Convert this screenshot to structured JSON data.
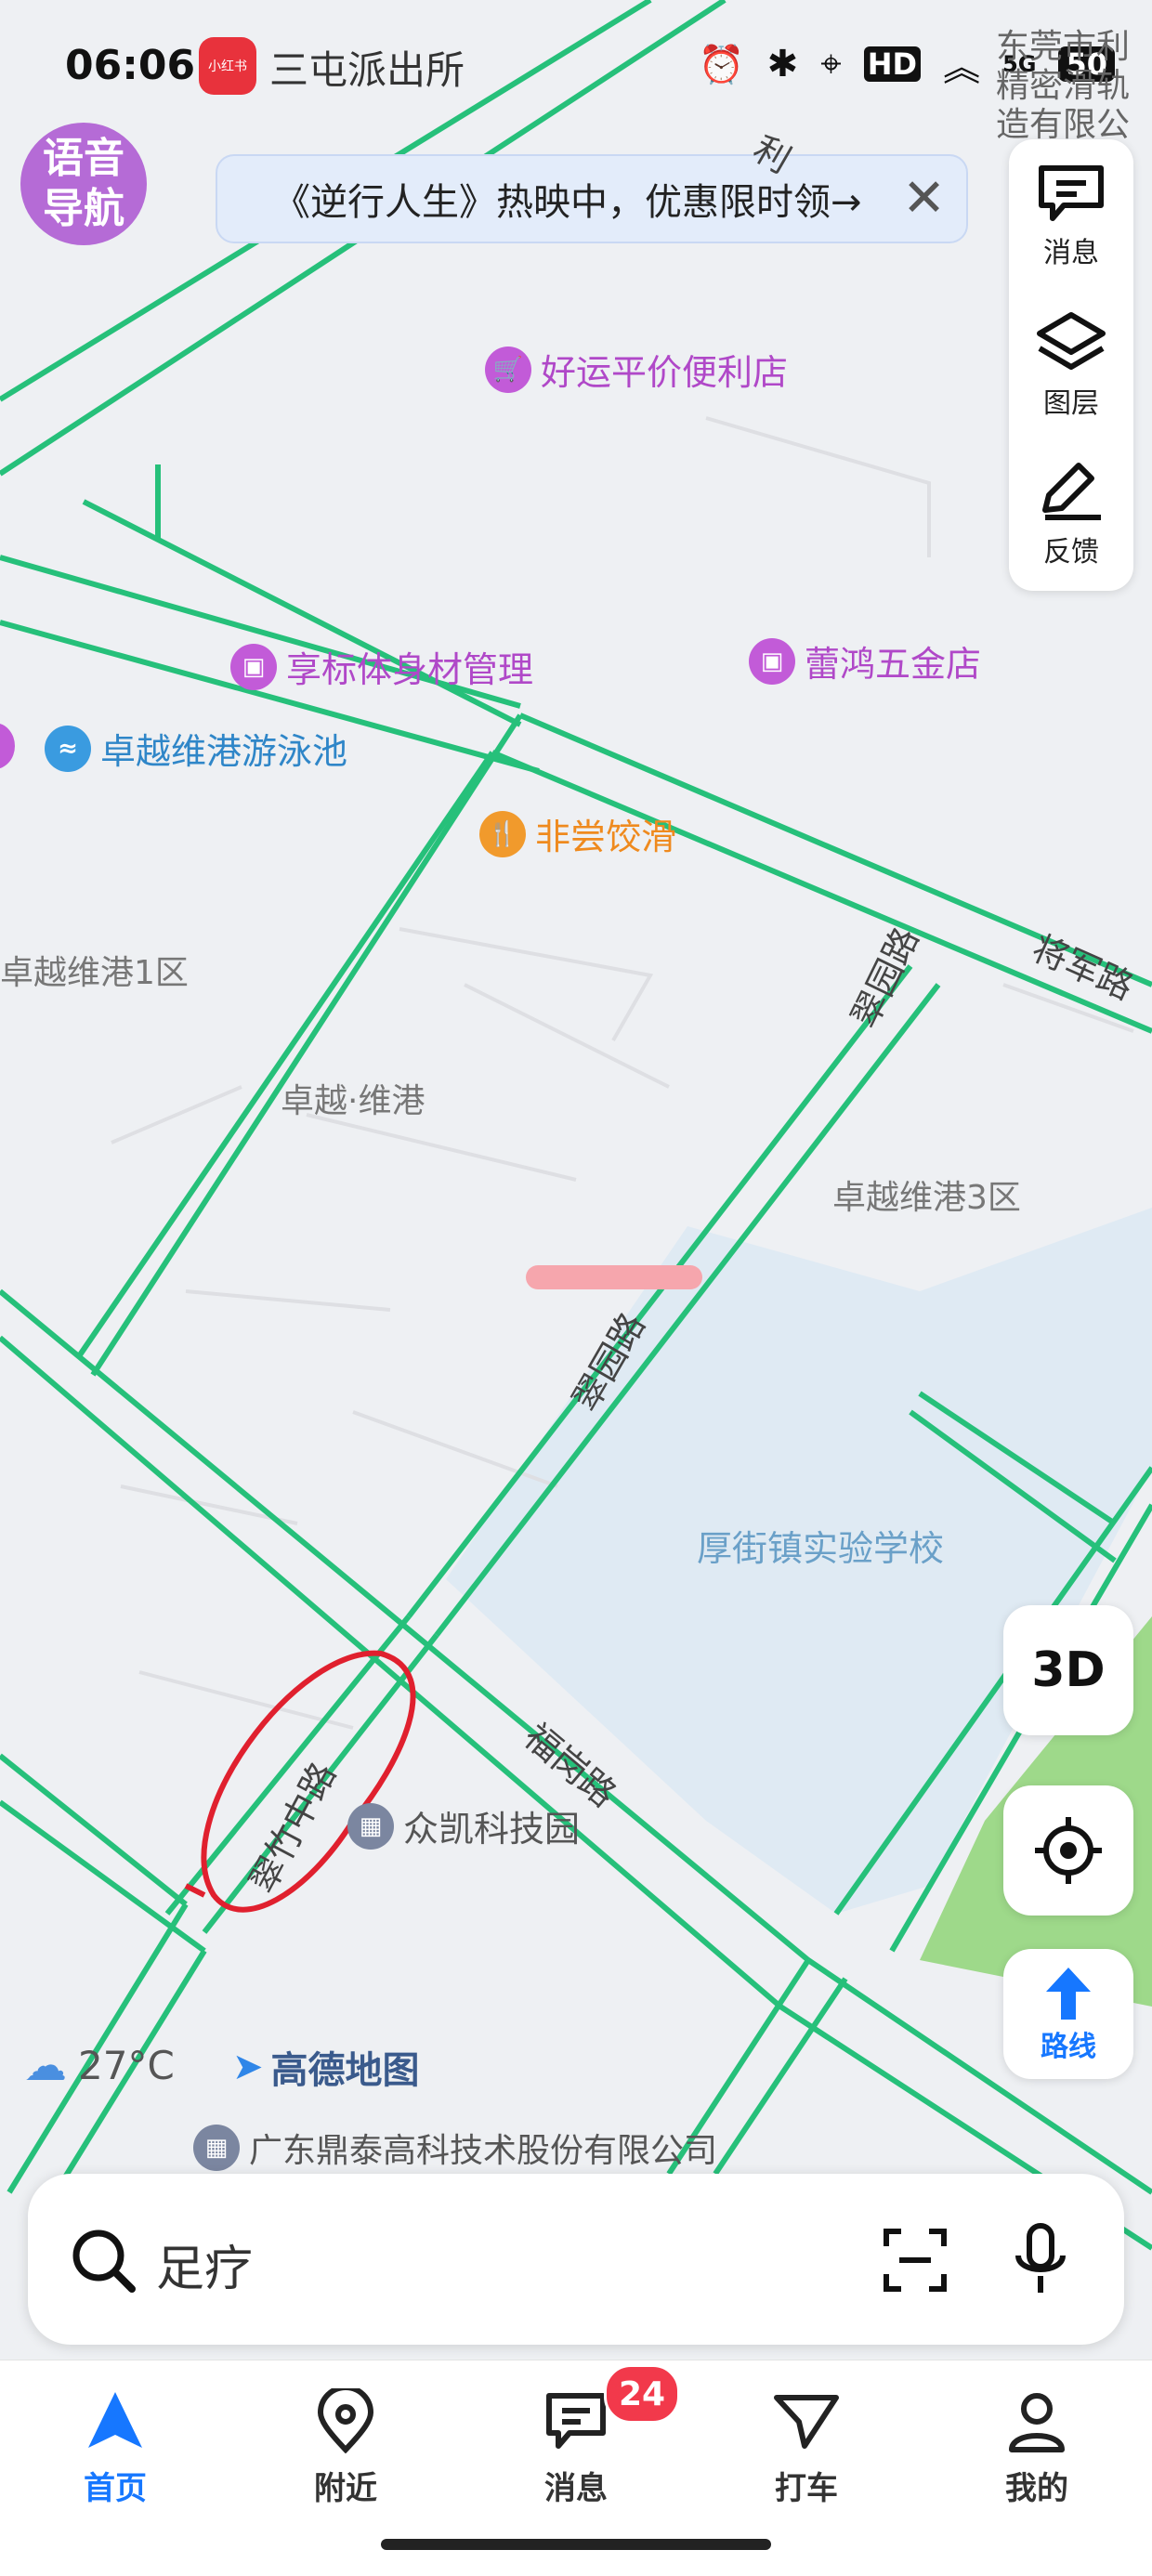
{
  "status_bar": {
    "time": "06:06",
    "app_badge_text": "小红书",
    "notification_text": "三屯派出所",
    "icons": [
      "alarm-icon",
      "bluetooth-icon",
      "location-icon",
      "hd-icon",
      "wifi-icon",
      "5g-icon",
      "battery-icon"
    ],
    "battery_level": "50"
  },
  "voice_nav": {
    "line1": "语音",
    "line2": "导航"
  },
  "promo_banner": {
    "text": "《逆行人生》热映中，优惠限时领→",
    "close_glyph": "✕"
  },
  "right_toolbar": {
    "message": "消息",
    "layers": "图层",
    "feedback": "反馈"
  },
  "map": {
    "pois": {
      "convenience_store": "好运平价便利店",
      "fitness": "享标体身材管理",
      "hardware": "蕾鸿五金店",
      "swimming": "卓越维港游泳池",
      "dumpling": "非尝饺滑",
      "tech_park": "众凯科技园",
      "company": "广东鼎泰高科技术股份有限公司",
      "top_right_company": "东莞市利精密滑轨造有限公"
    },
    "areas": {
      "zone1": "卓越维港1区",
      "zhuoyue": "卓越·维港",
      "zone3": "卓越维港3区",
      "school": "厚街镇实验学校"
    },
    "roads": {
      "cuiyuan_top": "翠园路",
      "cuiyuan_mid": "翠园路",
      "fugang": "福岗路",
      "cuizhu": "翠竹中路",
      "jiangjun": "将军路",
      "top_fragment": "利"
    },
    "weather": {
      "temp": "27°C"
    },
    "brand": "高德地图",
    "colors": {
      "road_outline": "#26c07a",
      "school_area": "#dfeaf3",
      "park": "#9ed98a",
      "annotation": "#e0202e"
    }
  },
  "buttons": {
    "three_d": "3D",
    "route": "路线"
  },
  "search": {
    "placeholder": "足疗"
  },
  "tabs": [
    {
      "label": "首页",
      "active": true
    },
    {
      "label": "附近",
      "active": false
    },
    {
      "label": "消息",
      "active": false
    },
    {
      "label": "打车",
      "active": false
    },
    {
      "label": "我的",
      "active": false
    }
  ],
  "message_badge": "24"
}
